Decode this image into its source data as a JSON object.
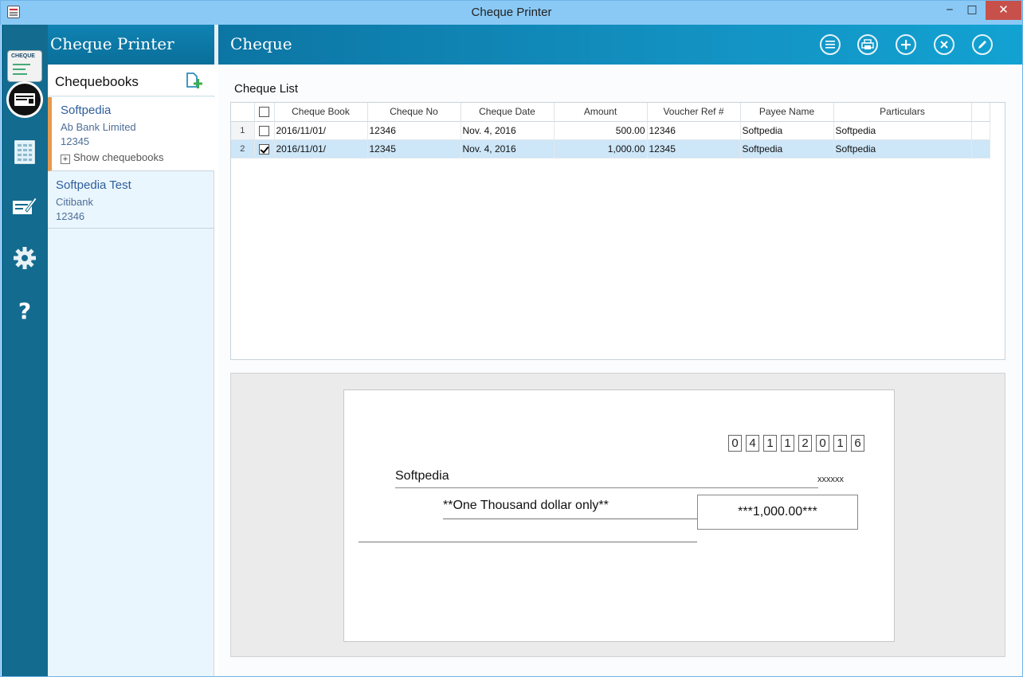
{
  "window": {
    "title": "Cheque Printer"
  },
  "app": {
    "name": "Cheque Printer",
    "logo_text": "CHEQUE"
  },
  "rail": {
    "items": [
      {
        "name": "chequebook-icon",
        "active": true
      },
      {
        "name": "ledger-icon",
        "active": false
      },
      {
        "name": "write-cheque-icon",
        "active": false
      },
      {
        "name": "gear-icon",
        "active": false
      },
      {
        "name": "help-icon",
        "active": false
      }
    ],
    "help_glyph": "?"
  },
  "left": {
    "title": "Chequebooks",
    "books": [
      {
        "name": "Softpedia",
        "bank": "Ab Bank Limited",
        "number": "12345",
        "show_label": "Show chequebooks",
        "plus": "+"
      },
      {
        "name": "Softpedia Test",
        "bank": "Citibank",
        "number": "12346"
      }
    ]
  },
  "main": {
    "title": "Cheque",
    "list_title": "Cheque List",
    "columns": [
      "Cheque Book",
      "Cheque No",
      "Cheque Date",
      "Amount",
      "Voucher Ref #",
      "Payee Name",
      "Particulars"
    ],
    "rows": [
      {
        "n": "1",
        "checked": false,
        "book": "2016/11/01/",
        "no": "12346",
        "date": "Nov. 4, 2016",
        "amount": "500.00",
        "voucher": "12346",
        "payee": "Softpedia",
        "particulars": "Softpedia"
      },
      {
        "n": "2",
        "checked": true,
        "book": "2016/11/01/",
        "no": "12345",
        "date": "Nov. 4, 2016",
        "amount": "1,000.00",
        "voucher": "12345",
        "payee": "Softpedia",
        "particulars": "Softpedia"
      }
    ],
    "selected_row": 2
  },
  "preview": {
    "date_digits": [
      "0",
      "4",
      "1",
      "1",
      "2",
      "0",
      "1",
      "6"
    ],
    "payee": "Softpedia",
    "suffix": "xxxxxx",
    "amount_words": "**One Thousand dollar only**",
    "amount_figures": "***1,000.00***"
  },
  "colors": {
    "rail": "#136b8f",
    "header": "#0f83b3",
    "accent": "#e59a4e",
    "selected_row": "#cde6f8",
    "link": "#2e5e9c"
  }
}
